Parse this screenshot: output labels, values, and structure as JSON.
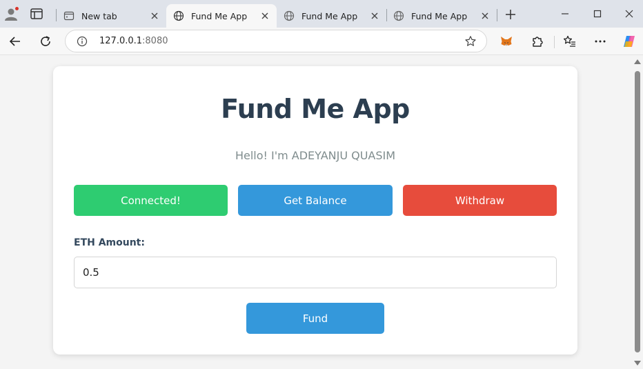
{
  "browser": {
    "tabs": [
      {
        "label": "New tab"
      },
      {
        "label": "Fund Me App"
      },
      {
        "label": "Fund Me App"
      },
      {
        "label": "Fund Me App"
      }
    ],
    "address": {
      "host": "127.0.0.1",
      "port": ":8080"
    }
  },
  "page": {
    "title": "Fund Me App",
    "subtitle": "Hello! I'm ADEYANJU QUASIM",
    "buttons": {
      "connect": "Connected!",
      "balance": "Get Balance",
      "withdraw": "Withdraw",
      "fund": "Fund"
    },
    "eth_label": "ETH Amount:",
    "eth_value": "0.5"
  },
  "colors": {
    "connect": "#2ecc71",
    "balance": "#3498db",
    "withdraw": "#e74c3c",
    "fund": "#3498db",
    "title": "#2c3e50"
  }
}
